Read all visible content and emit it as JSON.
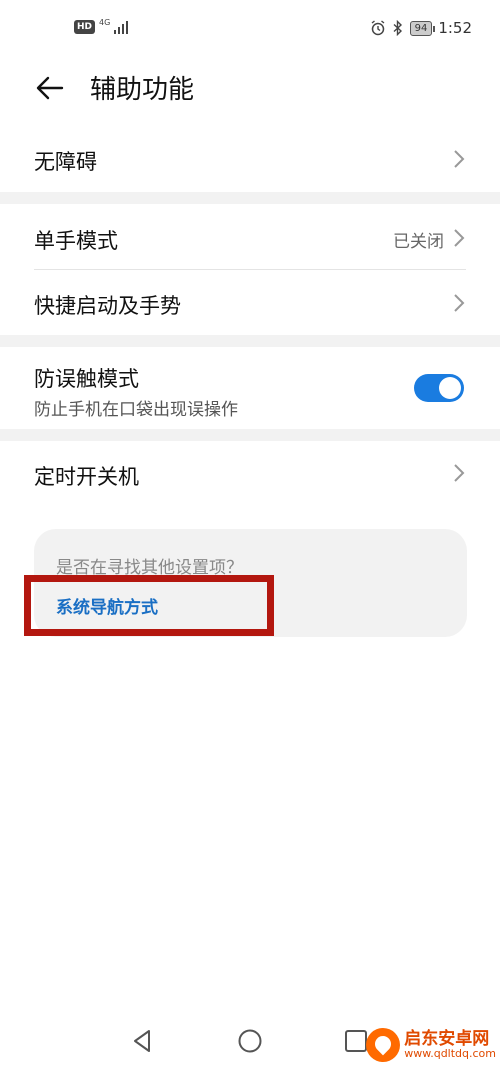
{
  "status_bar": {
    "hd_badge": "HD",
    "network": "4G",
    "battery": "94",
    "time": "1:52",
    "icons": [
      "alarm-icon",
      "bluetooth-icon"
    ]
  },
  "header": {
    "title": "辅助功能"
  },
  "rows": {
    "accessibility": {
      "title": "无障碍"
    },
    "one_hand_mode": {
      "title": "单手模式",
      "value": "已关闭"
    },
    "quick_launch": {
      "title": "快捷启动及手势"
    },
    "mistouch": {
      "title": "防误触模式",
      "subtitle": "防止手机在口袋出现误操作",
      "enabled": true
    },
    "scheduled_power": {
      "title": "定时开关机"
    }
  },
  "suggestion": {
    "question": "是否在寻找其他设置项？",
    "link": "系统导航方式"
  },
  "watermark": {
    "name": "启东安卓网",
    "url": "www.qdltdq.com"
  },
  "colors": {
    "accent": "#1a7ce0",
    "link": "#1a6fc4",
    "highlight_border": "#b3170f",
    "section_gap": "#f2f2f2"
  }
}
